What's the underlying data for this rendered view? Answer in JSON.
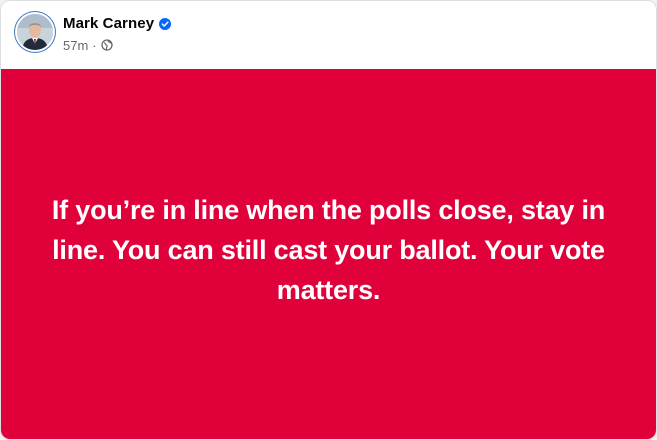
{
  "post": {
    "author_name": "Mark Carney",
    "timestamp": "57m",
    "separator": "·",
    "audience_icon": "globe-icon",
    "verified_icon": "verified-badge-icon",
    "image_text": "If you’re in line when the polls close, stay in line. You can still cast your ballot. Your vote matters."
  },
  "colors": {
    "image_background": "#e0003a",
    "verified_badge": "#0866ff",
    "meta_text": "#65676b"
  }
}
